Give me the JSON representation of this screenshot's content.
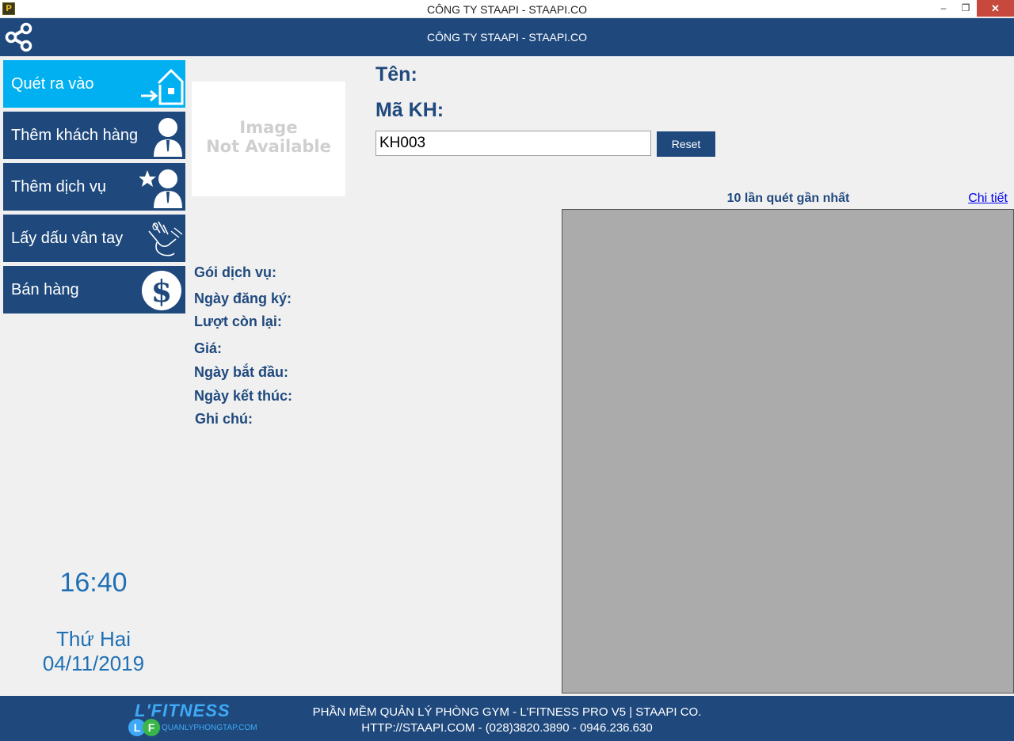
{
  "window": {
    "title": "CÔNG TY STAAPI - STAAPI.CO",
    "minimize": "–",
    "restore": "❐",
    "close": "✕"
  },
  "header": {
    "title": "CÔNG TY STAAPI - STAAPI.CO",
    "icon": "share-icon"
  },
  "menu": {
    "items": [
      {
        "label": "Quét ra vào",
        "icon": "enter-house-icon",
        "active": true
      },
      {
        "label": "Thêm khách hàng",
        "icon": "user-icon",
        "active": false
      },
      {
        "label": "Thêm dịch vụ",
        "icon": "star-user-icon",
        "active": false
      },
      {
        "label": "Lấy dấu vân tay",
        "icon": "fingerprint-hand-icon",
        "active": false
      },
      {
        "label": "Bán hàng",
        "icon": "dollar-icon",
        "active": false
      }
    ]
  },
  "photo": {
    "line1": "Image",
    "line2": "Not Available"
  },
  "customer": {
    "name_label": "Tên:",
    "code_label": "Mã KH:",
    "code_value": "KH003",
    "reset_label": "Reset"
  },
  "details": {
    "package_label": "Gói dịch vụ:",
    "register_date_label": "Ngày đăng ký:",
    "remaining_label": "Lượt còn lại:",
    "price_label": "Giá:",
    "start_date_label": "Ngày bắt đầu:",
    "end_date_label": "Ngày kết thúc:",
    "note_label": "Ghi chú:"
  },
  "recent": {
    "title": "10 lần quét gần nhất",
    "detail_link": "Chi tiết"
  },
  "clock": {
    "time": "16:40",
    "day": "Thứ Hai",
    "date": "04/11/2019"
  },
  "footer": {
    "brand": "L'FITNESS",
    "logo_l": "L",
    "logo_f": "F",
    "site": "QUANLYPHONGTAP.COM",
    "line1": "PHẦN MỀM QUẢN LÝ PHÒNG GYM - L'FITNESS PRO V5 | STAAPI CO.",
    "line2": "HTTP://STAAPI.COM - (028)3820.3890 - 0946.236.630"
  },
  "colors": {
    "primary": "#1f497d",
    "active": "#00b0f0",
    "clock": "#1f6fb5",
    "panel": "#ababab"
  }
}
